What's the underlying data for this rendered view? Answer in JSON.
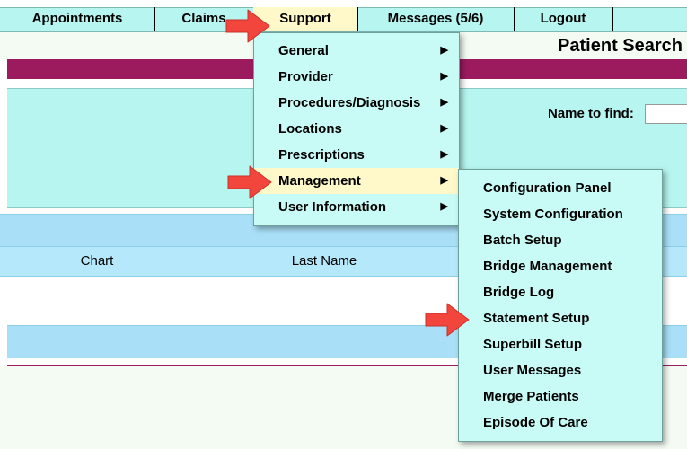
{
  "menubar": {
    "items": [
      {
        "label": "Appointments"
      },
      {
        "label": "Claims"
      },
      {
        "label": "Support"
      },
      {
        "label": "Messages (5/6)"
      },
      {
        "label": "Logout"
      }
    ]
  },
  "page": {
    "title": "Patient Search",
    "name_label": "Name to find:",
    "name_value": ""
  },
  "grid": {
    "columns": [
      "Chart",
      "Last Name"
    ]
  },
  "support_menu": {
    "items": [
      {
        "label": "General"
      },
      {
        "label": "Provider"
      },
      {
        "label": "Procedures/Diagnosis"
      },
      {
        "label": "Locations"
      },
      {
        "label": "Prescriptions"
      },
      {
        "label": "Management"
      },
      {
        "label": "User Information"
      }
    ]
  },
  "management_menu": {
    "items": [
      {
        "label": "Configuration Panel"
      },
      {
        "label": "System Configuration"
      },
      {
        "label": "Batch Setup"
      },
      {
        "label": "Bridge Management"
      },
      {
        "label": "Bridge Log"
      },
      {
        "label": "Statement Setup"
      },
      {
        "label": "Superbill Setup"
      },
      {
        "label": "User Messages"
      },
      {
        "label": "Merge Patients"
      },
      {
        "label": "Episode Of Care"
      }
    ]
  },
  "colors": {
    "accent_maroon": "#9b1b5e",
    "panel_cyan": "#b7f6f0",
    "menu_highlight": "#fff8c8",
    "arrow_red": "#f2463c"
  }
}
